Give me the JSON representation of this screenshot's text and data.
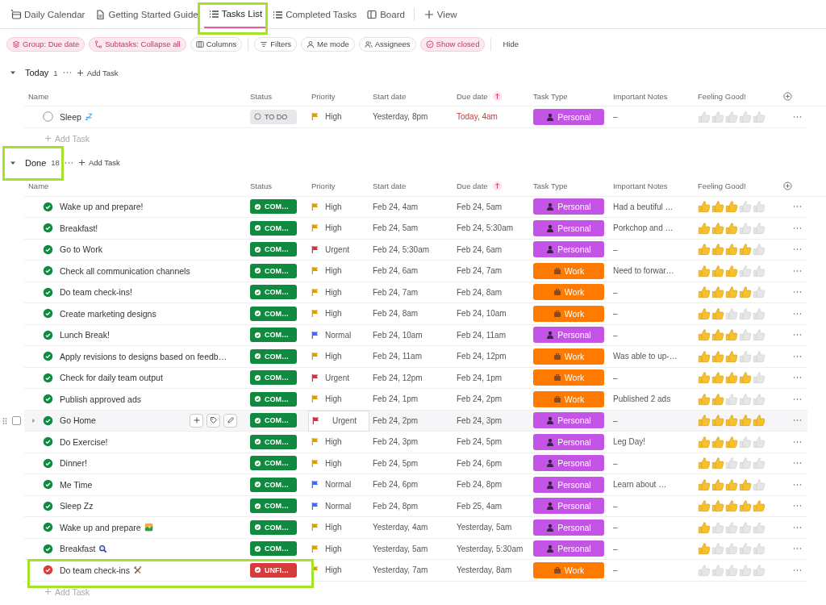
{
  "tabs": [
    {
      "label": "Daily Calendar",
      "selected": false,
      "highlighted": false
    },
    {
      "label": "Getting Started Guide",
      "selected": false,
      "highlighted": false
    },
    {
      "label": "Tasks List",
      "selected": true,
      "highlighted": true
    },
    {
      "label": "Completed Tasks",
      "selected": false,
      "highlighted": false
    },
    {
      "label": "Board",
      "selected": false,
      "highlighted": false
    },
    {
      "label": "View",
      "selected": false,
      "highlighted": false
    }
  ],
  "toolbar": [
    {
      "label": "Group: Due date",
      "kind": "group",
      "active": true
    },
    {
      "label": "Subtasks: Collapse all",
      "kind": "subtasks",
      "active": true
    },
    {
      "label": "Columns",
      "kind": "columns",
      "active": false
    },
    {
      "label": "Filters",
      "kind": "filters",
      "active": false
    },
    {
      "label": "Me mode",
      "kind": "me",
      "active": false
    },
    {
      "label": "Assignees",
      "kind": "assignees",
      "active": false
    },
    {
      "label": "Show closed",
      "kind": "closed",
      "active": true
    },
    {
      "label": "Hide",
      "kind": "hide",
      "active": false
    }
  ],
  "groups": [
    {
      "title": "Today",
      "count": "1",
      "add_label": "Add Task",
      "highlighted": false,
      "expanded": true,
      "columns": [
        "Name",
        "Status",
        "Priority",
        "Start date",
        "Due date",
        "Task Type",
        "Important Notes",
        "Feeling Good!"
      ],
      "rows": [
        {
          "name": "Sleep",
          "status": {
            "label": "TO DO",
            "kind": "todo"
          },
          "priority": {
            "label": "High",
            "kind": "high"
          },
          "start": "Yesterday, 8pm",
          "due": "Today, 4am",
          "overdue": true,
          "type": {
            "label": "Personal",
            "kind": "personal"
          },
          "notes": "–",
          "stars": 0,
          "hovered": false,
          "highlighted": false
        }
      ],
      "footer": "Add Task"
    },
    {
      "title": "Done",
      "count": "18",
      "add_label": "Add Task",
      "highlighted": true,
      "expanded": true,
      "columns": [
        "Name",
        "Status",
        "Priority",
        "Start date",
        "Due date",
        "Task Type",
        "Important Notes",
        "Feeling Good!"
      ],
      "rows": [
        {
          "name": "Wake up and prepare!",
          "status": {
            "label": "COM…",
            "kind": "complete"
          },
          "priority": {
            "label": "High",
            "kind": "high"
          },
          "start": "Feb 24, 4am",
          "due": "Feb 24, 5am",
          "overdue": false,
          "type": {
            "label": "Personal",
            "kind": "personal"
          },
          "notes": "Had a beutiful …",
          "stars": 3,
          "hovered": false,
          "highlighted": false
        },
        {
          "name": "Breakfast!",
          "status": {
            "label": "COM…",
            "kind": "complete"
          },
          "priority": {
            "label": "High",
            "kind": "high"
          },
          "start": "Feb 24, 5am",
          "due": "Feb 24, 5:30am",
          "overdue": false,
          "type": {
            "label": "Personal",
            "kind": "personal"
          },
          "notes": "Porkchop and …",
          "stars": 3,
          "hovered": false,
          "highlighted": false
        },
        {
          "name": "Go to Work",
          "status": {
            "label": "COM…",
            "kind": "complete"
          },
          "priority": {
            "label": "Urgent",
            "kind": "urgent"
          },
          "start": "Feb 24, 5:30am",
          "due": "Feb 24, 6am",
          "overdue": false,
          "type": {
            "label": "Personal",
            "kind": "personal"
          },
          "notes": "–",
          "stars": 4,
          "hovered": false,
          "highlighted": false
        },
        {
          "name": "Check all communication channels",
          "status": {
            "label": "COM…",
            "kind": "complete"
          },
          "priority": {
            "label": "High",
            "kind": "high"
          },
          "start": "Feb 24, 6am",
          "due": "Feb 24, 7am",
          "overdue": false,
          "type": {
            "label": "Work",
            "kind": "work"
          },
          "notes": "Need to forwar…",
          "stars": 3,
          "hovered": false,
          "highlighted": false
        },
        {
          "name": "Do team check-ins!",
          "status": {
            "label": "COM…",
            "kind": "complete"
          },
          "priority": {
            "label": "High",
            "kind": "high"
          },
          "start": "Feb 24, 7am",
          "due": "Feb 24, 8am",
          "overdue": false,
          "type": {
            "label": "Work",
            "kind": "work"
          },
          "notes": "–",
          "stars": 4,
          "hovered": false,
          "highlighted": false
        },
        {
          "name": "Create marketing designs",
          "status": {
            "label": "COM…",
            "kind": "complete"
          },
          "priority": {
            "label": "High",
            "kind": "high"
          },
          "start": "Feb 24, 8am",
          "due": "Feb 24, 10am",
          "overdue": false,
          "type": {
            "label": "Work",
            "kind": "work"
          },
          "notes": "–",
          "stars": 2,
          "hovered": false,
          "highlighted": false
        },
        {
          "name": "Lunch Break!",
          "status": {
            "label": "COM…",
            "kind": "complete"
          },
          "priority": {
            "label": "Normal",
            "kind": "normal"
          },
          "start": "Feb 24, 10am",
          "due": "Feb 24, 11am",
          "overdue": false,
          "type": {
            "label": "Personal",
            "kind": "personal"
          },
          "notes": "–",
          "stars": 3,
          "hovered": false,
          "highlighted": false
        },
        {
          "name": "Apply revisions to designs based on feedb…",
          "status": {
            "label": "COM…",
            "kind": "complete"
          },
          "priority": {
            "label": "High",
            "kind": "high"
          },
          "start": "Feb 24, 11am",
          "due": "Feb 24, 12pm",
          "overdue": false,
          "type": {
            "label": "Work",
            "kind": "work"
          },
          "notes": "Was able to up-…",
          "stars": 3,
          "hovered": false,
          "highlighted": false
        },
        {
          "name": "Check for daily team output",
          "status": {
            "label": "COM…",
            "kind": "complete"
          },
          "priority": {
            "label": "Urgent",
            "kind": "urgent"
          },
          "start": "Feb 24, 12pm",
          "due": "Feb 24, 1pm",
          "overdue": false,
          "type": {
            "label": "Work",
            "kind": "work"
          },
          "notes": "–",
          "stars": 4,
          "hovered": false,
          "highlighted": false
        },
        {
          "name": "Publish approved ads",
          "status": {
            "label": "COM…",
            "kind": "complete"
          },
          "priority": {
            "label": "High",
            "kind": "high"
          },
          "start": "Feb 24, 1pm",
          "due": "Feb 24, 2pm",
          "overdue": false,
          "type": {
            "label": "Work",
            "kind": "work"
          },
          "notes": "Published 2 ads",
          "stars": 2,
          "hovered": false,
          "highlighted": false
        },
        {
          "name": "Go Home",
          "status": {
            "label": "COM…",
            "kind": "complete"
          },
          "priority": {
            "label": "Urgent",
            "kind": "urgent"
          },
          "start": "Feb 24, 2pm",
          "due": "Feb 24, 3pm",
          "overdue": false,
          "type": {
            "label": "Personal",
            "kind": "personal"
          },
          "notes": "–",
          "stars": 5,
          "hovered": true,
          "highlighted": false
        },
        {
          "name": "Do Exercise!",
          "status": {
            "label": "COM…",
            "kind": "complete"
          },
          "priority": {
            "label": "High",
            "kind": "high"
          },
          "start": "Feb 24, 3pm",
          "due": "Feb 24, 5pm",
          "overdue": false,
          "type": {
            "label": "Personal",
            "kind": "personal"
          },
          "notes": "Leg Day!",
          "stars": 3,
          "hovered": false,
          "highlighted": false
        },
        {
          "name": "Dinner!",
          "status": {
            "label": "COM…",
            "kind": "complete"
          },
          "priority": {
            "label": "High",
            "kind": "high"
          },
          "start": "Feb 24, 5pm",
          "due": "Feb 24, 6pm",
          "overdue": false,
          "type": {
            "label": "Personal",
            "kind": "personal"
          },
          "notes": "–",
          "stars": 2,
          "hovered": false,
          "highlighted": false
        },
        {
          "name": "Me Time",
          "status": {
            "label": "COM…",
            "kind": "complete"
          },
          "priority": {
            "label": "Normal",
            "kind": "normal"
          },
          "start": "Feb 24, 6pm",
          "due": "Feb 24, 8pm",
          "overdue": false,
          "type": {
            "label": "Personal",
            "kind": "personal"
          },
          "notes": "Learn about …",
          "stars": 4,
          "hovered": false,
          "highlighted": false
        },
        {
          "name": "Sleep Zz",
          "status": {
            "label": "COM…",
            "kind": "complete"
          },
          "priority": {
            "label": "Normal",
            "kind": "normal"
          },
          "start": "Feb 24, 8pm",
          "due": "Feb 25, 4am",
          "overdue": false,
          "type": {
            "label": "Personal",
            "kind": "personal"
          },
          "notes": "–",
          "stars": 5,
          "hovered": false,
          "highlighted": false
        },
        {
          "name": "Wake up and prepare",
          "status": {
            "label": "COM…",
            "kind": "complete"
          },
          "priority": {
            "label": "High",
            "kind": "high"
          },
          "start": "Yesterday, 4am",
          "due": "Yesterday, 5am",
          "overdue": false,
          "type": {
            "label": "Personal",
            "kind": "personal"
          },
          "notes": "–",
          "stars": 1,
          "hovered": false,
          "highlighted": false
        },
        {
          "name": "Breakfast",
          "status": {
            "label": "COM…",
            "kind": "complete"
          },
          "priority": {
            "label": "High",
            "kind": "high"
          },
          "start": "Yesterday, 5am",
          "due": "Yesterday, 5:30am",
          "overdue": false,
          "type": {
            "label": "Personal",
            "kind": "personal"
          },
          "notes": "–",
          "stars": 1,
          "hovered": false,
          "highlighted": false
        },
        {
          "name": "Do team check-ins",
          "status": {
            "label": "UNFI…",
            "kind": "unfinished"
          },
          "priority": {
            "label": "High",
            "kind": "high"
          },
          "start": "Yesterday, 7am",
          "due": "Yesterday, 8am",
          "overdue": false,
          "type": {
            "label": "Work",
            "kind": "work"
          },
          "notes": "–",
          "stars": 0,
          "hovered": false,
          "highlighted": true
        }
      ],
      "footer": "Add Task"
    }
  ]
}
